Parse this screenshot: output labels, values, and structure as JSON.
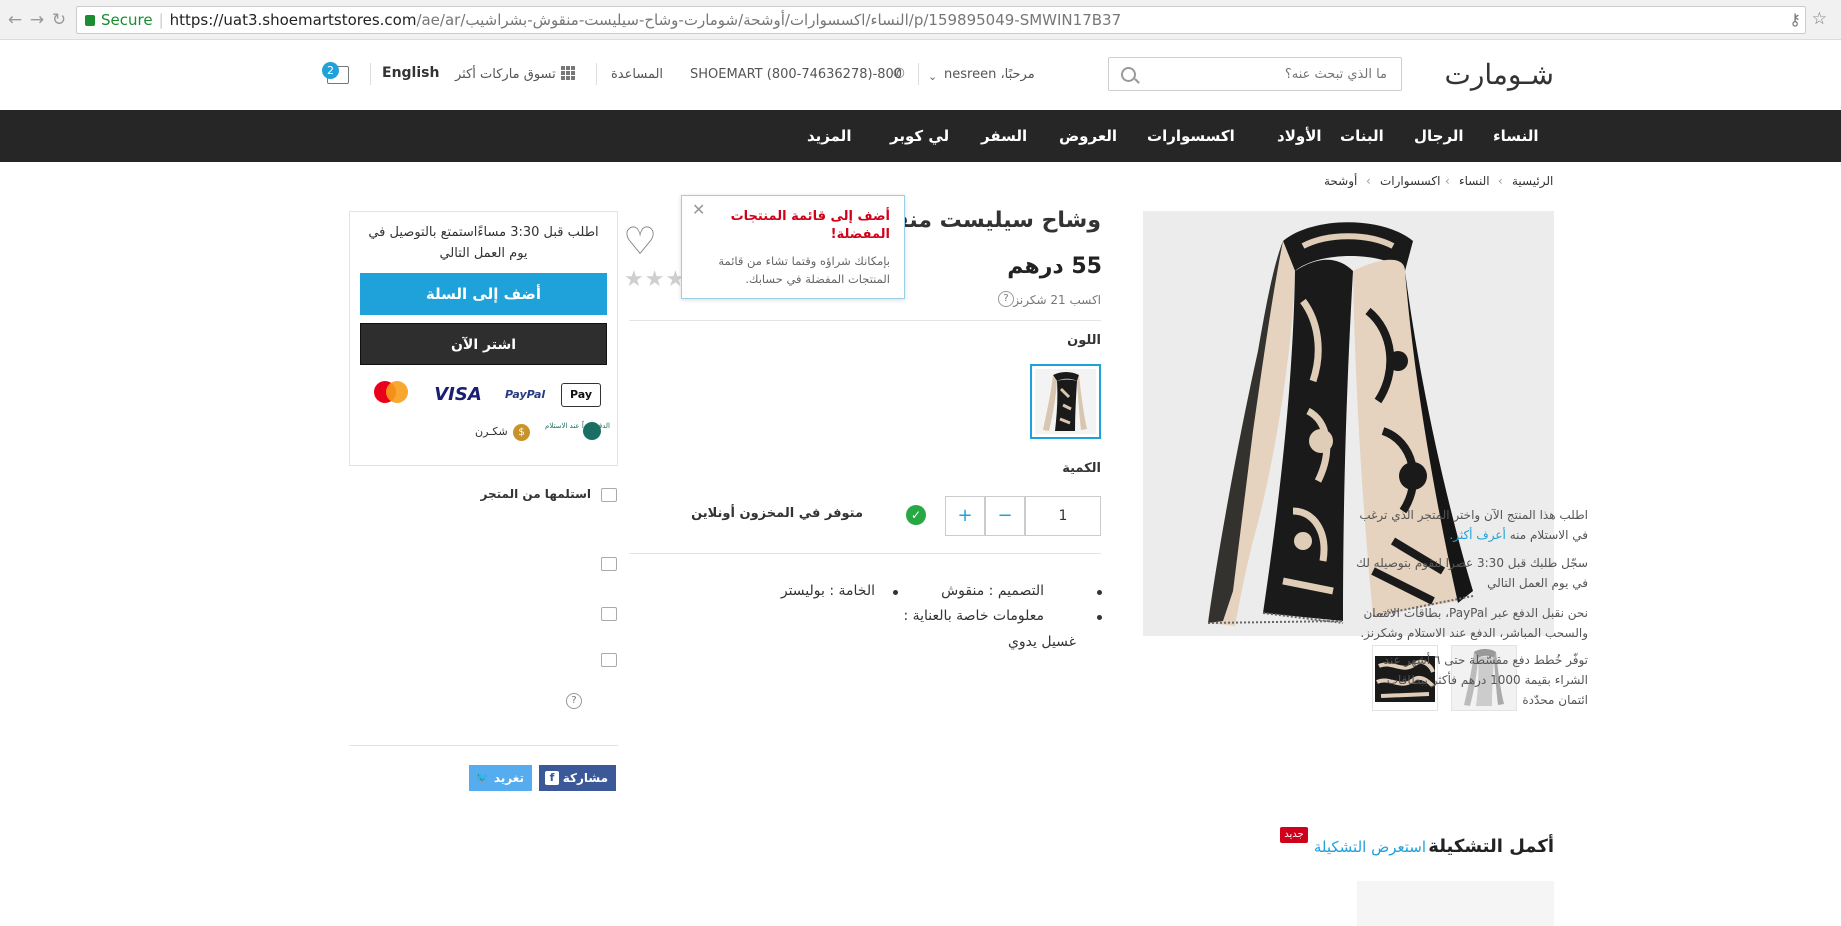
{
  "browser": {
    "secure_label": "Secure",
    "url_host": "https://uat3.shoemartstores.com",
    "url_path": "/ae/ar/النساء/اكسسوارات/أوشحة/شومارت-وشاح-سيليست-منقوش-بشراشيب/p/159895049-SMWIN17B37"
  },
  "header": {
    "logo": "شـومارت",
    "search_placeholder": "ما الذي تبحث عنه؟",
    "greeting": "مرحبًا، nesreen",
    "phone": "800-SHOEMART (800-74636278)",
    "help": "المساعدة",
    "brands": "تسوق ماركات أكثر",
    "language": "English",
    "cart_count": "2"
  },
  "nav": {
    "items": [
      "النساء",
      "الرجال",
      "البنات",
      "الأولاد",
      "اكسسوارات",
      "العروض",
      "السفر",
      "لي كوبر",
      "المزيد"
    ]
  },
  "breadcrumb": [
    "الرئيسية",
    "النساء",
    "اكسسوارات",
    "أوشحة"
  ],
  "product": {
    "title": "وشاح سيليست منقوش",
    "price": "55  درهم",
    "points": "اكسب 21 شكرنز",
    "color_label": "اللون",
    "quantity_label": "الكمية",
    "quantity_value": "1",
    "stock_status": "متوفر في المخزون أونلاين",
    "specs": {
      "design": "التصميم : منقوش",
      "material": "الخامة : بوليستر",
      "care_label": "معلومات خاصة بالعناية :",
      "care_value": "غسيل يدوي"
    }
  },
  "wishlist_tooltip": {
    "title": "أضف إلى قائمة المنتجات المفضلة!",
    "body": "بإمكانك شراؤه وقتما تشاء من قائمة المنتجات المفضلة في حسابك."
  },
  "buy_box": {
    "delivery_note": "اطلب قبل 3:30 مساءًاستمتع بالتوصيل في يوم العمل التالي",
    "add_to_cart": "أضف إلى السلة",
    "buy_now": "اشتر الآن",
    "payments": {
      "apple_pay": "Pay",
      "paypal": "PayPal",
      "visa": "VISA",
      "mastercard": "mastercard",
      "cod": "الدفع نقداً عند الاستلام",
      "shukran": "شكـرن"
    }
  },
  "services": {
    "pickup_title": "استلمها من المتجر",
    "pickup_text": "اطلب هذا المنتج الآن واختر المتجر الذي ترغب في الاستلام منه",
    "pickup_link": "أعرف أكثر.",
    "delivery_text": "سجّل طلبك قبل 3:30 عصرا لنقوم بتوصيله لك في يوم العمل التالي",
    "payment_text": "نحن نقبل الدفع عبر PayPal، بطاقات الائتمان والسحب المباشر، الدفع عند الاستلام وشكرنز.",
    "installments_text": "توفّر خُطط دفع مقسّطة حتى ٦ أشهر عند الشراء بقيمة 1000 درهم فأكثر ببطاقات ائتمان محدّدة"
  },
  "share": {
    "facebook": "مشاركة",
    "twitter": "تغريد"
  },
  "complete_look": {
    "title": "أكمل التشكيلة",
    "link": "استعرض التشكيلة",
    "badge": "جديد"
  },
  "colors": {
    "accent": "#1ea2d9",
    "nav_bg": "#262626",
    "alert": "#d0021b",
    "success": "#27a842"
  }
}
